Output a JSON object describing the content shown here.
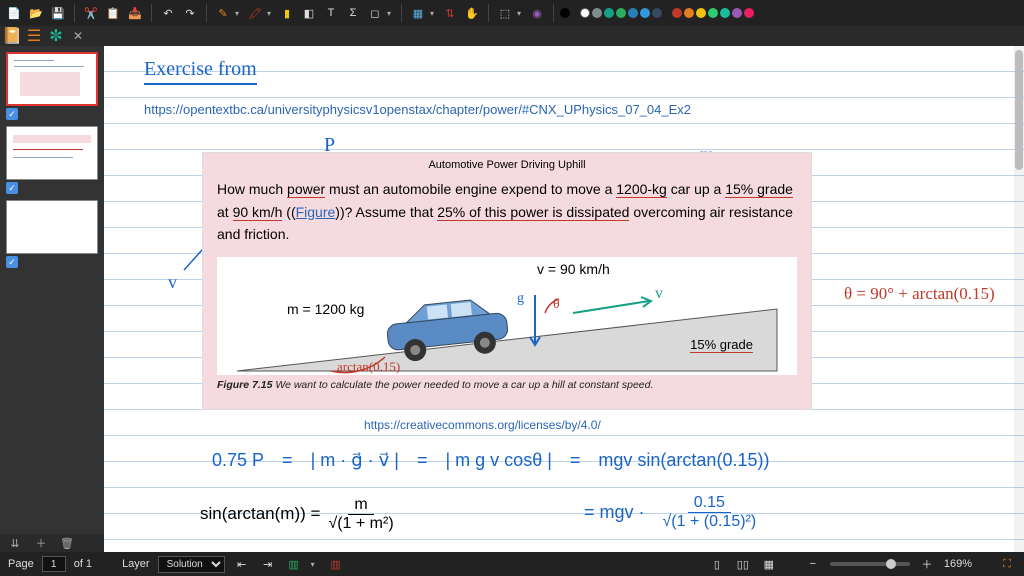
{
  "toolbar": {
    "icons": [
      "new-doc",
      "open",
      "save",
      "cut",
      "copy",
      "paste",
      "undo",
      "redo",
      "pen",
      "marker",
      "highlighter",
      "eraser",
      "text",
      "math",
      "shape",
      "image",
      "ruler",
      "hand",
      "select",
      "smudge"
    ],
    "colors": [
      "#000000",
      "#ffffff",
      "#808080",
      "#1abc9c",
      "#27ae60",
      "#2980b9",
      "#3498db",
      "#8e44ad",
      "#e74c3c",
      "#e67e22",
      "#f1c40f",
      "#ecf0f1",
      "#95a5a6",
      "#16a085",
      "#2c3e50"
    ]
  },
  "page": {
    "title": "Exercise from",
    "source_url": "https://opentextbc.ca/universityphysicsv1openstax/chapter/power/#CNX_UPhysics_07_04_Ex2",
    "license_url": "https://creativecommons.org/licenses/by/4.0/"
  },
  "problem": {
    "heading": "Automotive Power Driving Uphill",
    "text_1": "How much ",
    "text_power": "power",
    "text_2": " must an automobile engine expend to move a ",
    "text_mass": "1200-kg",
    "text_3": " car up a ",
    "text_grade": "15% grade",
    "text_4": " at ",
    "text_speed": "90 km/h",
    "text_5": " ((",
    "fig_link": "Figure",
    "text_6": "))? Assume that ",
    "text_loss": "25% of this power is dissipated",
    "text_7": " overcoming air resistance and friction.",
    "caption_label": "Figure 7.15",
    "caption_text": " We want to calculate the power needed to move a car up a hill at constant speed.",
    "diagram": {
      "m_label": "m = 1200 kg",
      "v_label": "v = 90 km/h",
      "g_label": "g",
      "v_arrow": "v",
      "theta": "θ",
      "grade_label": "15% grade",
      "arctan": "arctan(0.15)"
    }
  },
  "annotations": {
    "P": "P",
    "m": "m",
    "v": "v",
    "theta_eq": "θ = 90° + arctan(0.15)"
  },
  "work": {
    "line1_a": "0.75 P",
    "line1_eq": "=",
    "line1_b": "| m · g⃗ · v⃗ |",
    "line1_c": "| m g v cosθ |",
    "line1_d": "mgv sin(arctan(0.15))",
    "identity_lhs": "sin(arctan(m)) =",
    "identity_num": "m",
    "identity_den": "√(1 + m²)",
    "line2_a": "= mgv ·",
    "line2_num": "0.15",
    "line2_den": "√(1 + (0.15)²)"
  },
  "status": {
    "page_label": "Page",
    "page_current": "1",
    "page_of": "of 1",
    "layer_label": "Layer",
    "layer_value": "Solution",
    "zoom": "169%"
  },
  "thumbnails": {
    "count": 3,
    "selected": 0
  }
}
